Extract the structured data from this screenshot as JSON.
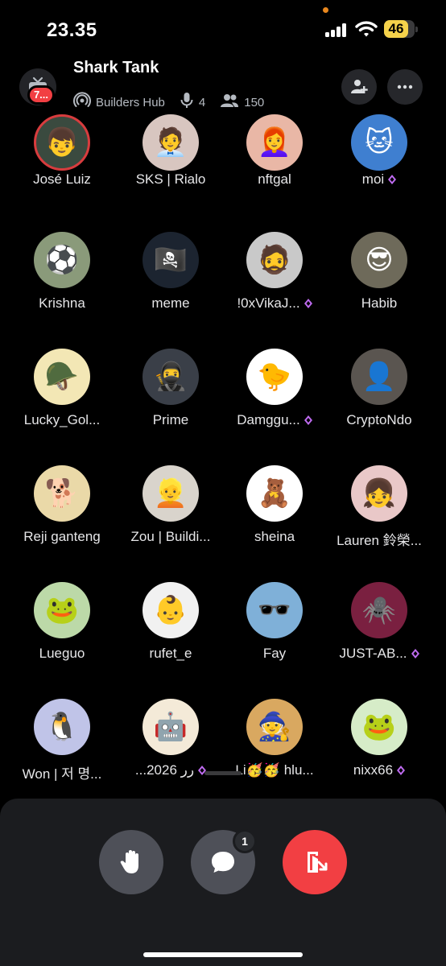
{
  "status_bar": {
    "time": "23.35",
    "battery": "46"
  },
  "header": {
    "server_badge": "7...",
    "title": "Shark Tank",
    "server_name": "Builders Hub",
    "speakers": "4",
    "listeners": "150"
  },
  "participants": [
    {
      "name": "José Luiz",
      "emoji": "👦",
      "bg": "#3a4a3f",
      "speaking": true,
      "badge": false
    },
    {
      "name": "SKS | Rialo",
      "emoji": "🧑‍💼",
      "bg": "#d8c6c0",
      "speaking": false,
      "badge": false
    },
    {
      "name": "nftgal",
      "emoji": "👩‍🦰",
      "bg": "#e9b7a6",
      "speaking": false,
      "badge": false
    },
    {
      "name": "moi",
      "emoji": "🐱",
      "bg": "#3f7fd0",
      "speaking": false,
      "badge": true
    },
    {
      "name": "Krishna",
      "emoji": "⚽",
      "bg": "#8a9a7a",
      "speaking": false,
      "badge": false
    },
    {
      "name": "meme",
      "emoji": "🏴‍☠️",
      "bg": "#1c2430",
      "speaking": false,
      "badge": false
    },
    {
      "name": "!0xVikaJ...",
      "emoji": "🧔",
      "bg": "#c9c9c9",
      "speaking": false,
      "badge": true
    },
    {
      "name": "Habib",
      "emoji": "😎",
      "bg": "#6e6a5a",
      "speaking": false,
      "badge": false
    },
    {
      "name": "Lucky_Gol...",
      "emoji": "🪖",
      "bg": "#f3e7b5",
      "speaking": false,
      "badge": false
    },
    {
      "name": "Prime",
      "emoji": "🥷",
      "bg": "#3a3f48",
      "speaking": false,
      "badge": false
    },
    {
      "name": "Damggu...",
      "emoji": "🐤",
      "bg": "#ffffff",
      "speaking": false,
      "badge": true
    },
    {
      "name": "CryptoNdo",
      "emoji": "👤",
      "bg": "#5a5550",
      "speaking": false,
      "badge": false
    },
    {
      "name": "Reji ganteng",
      "emoji": "🐕",
      "bg": "#ead9a8",
      "speaking": false,
      "badge": false
    },
    {
      "name": "Zou | Buildi...",
      "emoji": "👱",
      "bg": "#d9d4cc",
      "speaking": false,
      "badge": false
    },
    {
      "name": "sheina",
      "emoji": "🧸",
      "bg": "#ffffff",
      "speaking": false,
      "badge": false
    },
    {
      "name": "Lauren 鈴榮...",
      "emoji": "👧",
      "bg": "#e9c8c8",
      "speaking": false,
      "badge": false
    },
    {
      "name": "Lueguo",
      "emoji": "🐸",
      "bg": "#bcd9a8",
      "speaking": false,
      "badge": false
    },
    {
      "name": "rufet_e",
      "emoji": "👶",
      "bg": "#f1f1f1",
      "speaking": false,
      "badge": false
    },
    {
      "name": "Fay",
      "emoji": "🕶️",
      "bg": "#7fb0d8",
      "speaking": false,
      "badge": false
    },
    {
      "name": "JUST-AB...",
      "emoji": "🕷️",
      "bg": "#7a2040",
      "speaking": false,
      "badge": true
    },
    {
      "name": "Won | 저 명...",
      "emoji": "🐧",
      "bg": "#c0c4e8",
      "speaking": false,
      "badge": false
    },
    {
      "name": "...ﺭﺭ 2026",
      "emoji": "🤖",
      "bg": "#f4ead8",
      "speaking": false,
      "badge": true
    },
    {
      "name": "Li🥳🥳 hlu...",
      "emoji": "🧙",
      "bg": "#d9a860",
      "speaking": false,
      "badge": false
    },
    {
      "name": "nixx66",
      "emoji": "🐸",
      "bg": "#d6ecc8",
      "speaking": false,
      "badge": true
    }
  ],
  "controls": {
    "chat_badge": "1",
    "raise_hand_color": "#4e5058",
    "chat_color": "#4e5058",
    "leave_color": "#f23f43"
  },
  "colors": {
    "badge_gem": "#c06cf2",
    "speaking_ring": "#d83c3e"
  }
}
